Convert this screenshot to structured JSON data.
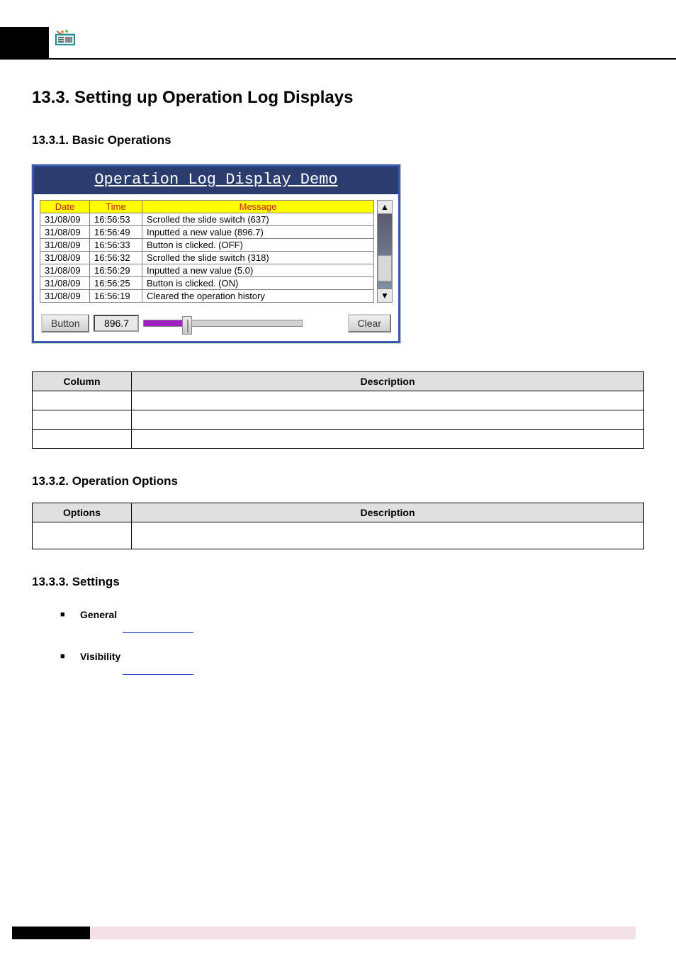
{
  "headings": {
    "h1": "13.3.  Setting up Operation Log Displays",
    "s1": "13.3.1. Basic Operations",
    "s2": "13.3.2. Operation Options",
    "s3": "13.3.3. Settings"
  },
  "demo": {
    "title": "Operation Log Display Demo",
    "columns": {
      "date": "Date",
      "time": "Time",
      "message": "Message"
    },
    "rows": [
      {
        "date": "31/08/09",
        "time": "16:56:53",
        "msg": "Scrolled the slide switch (637)"
      },
      {
        "date": "31/08/09",
        "time": "16:56:49",
        "msg": "Inputted a new value (896.7)"
      },
      {
        "date": "31/08/09",
        "time": "16:56:33",
        "msg": "Button is clicked. (OFF)"
      },
      {
        "date": "31/08/09",
        "time": "16:56:32",
        "msg": "Scrolled the slide switch (318)"
      },
      {
        "date": "31/08/09",
        "time": "16:56:29",
        "msg": "Inputted a new value (5.0)"
      },
      {
        "date": "31/08/09",
        "time": "16:56:25",
        "msg": "Button is clicked. (ON)"
      },
      {
        "date": "31/08/09",
        "time": "16:56:19",
        "msg": "Cleared the operation history"
      }
    ],
    "footer": {
      "button": "Button",
      "value": "896.7",
      "clear": "Clear"
    }
  },
  "tables": {
    "column_desc": {
      "h1": "Column",
      "h2": "Description"
    },
    "options_desc": {
      "h1": "Options",
      "h2": "Description"
    }
  },
  "bullets": {
    "general": "General",
    "visibility": "Visibility"
  }
}
